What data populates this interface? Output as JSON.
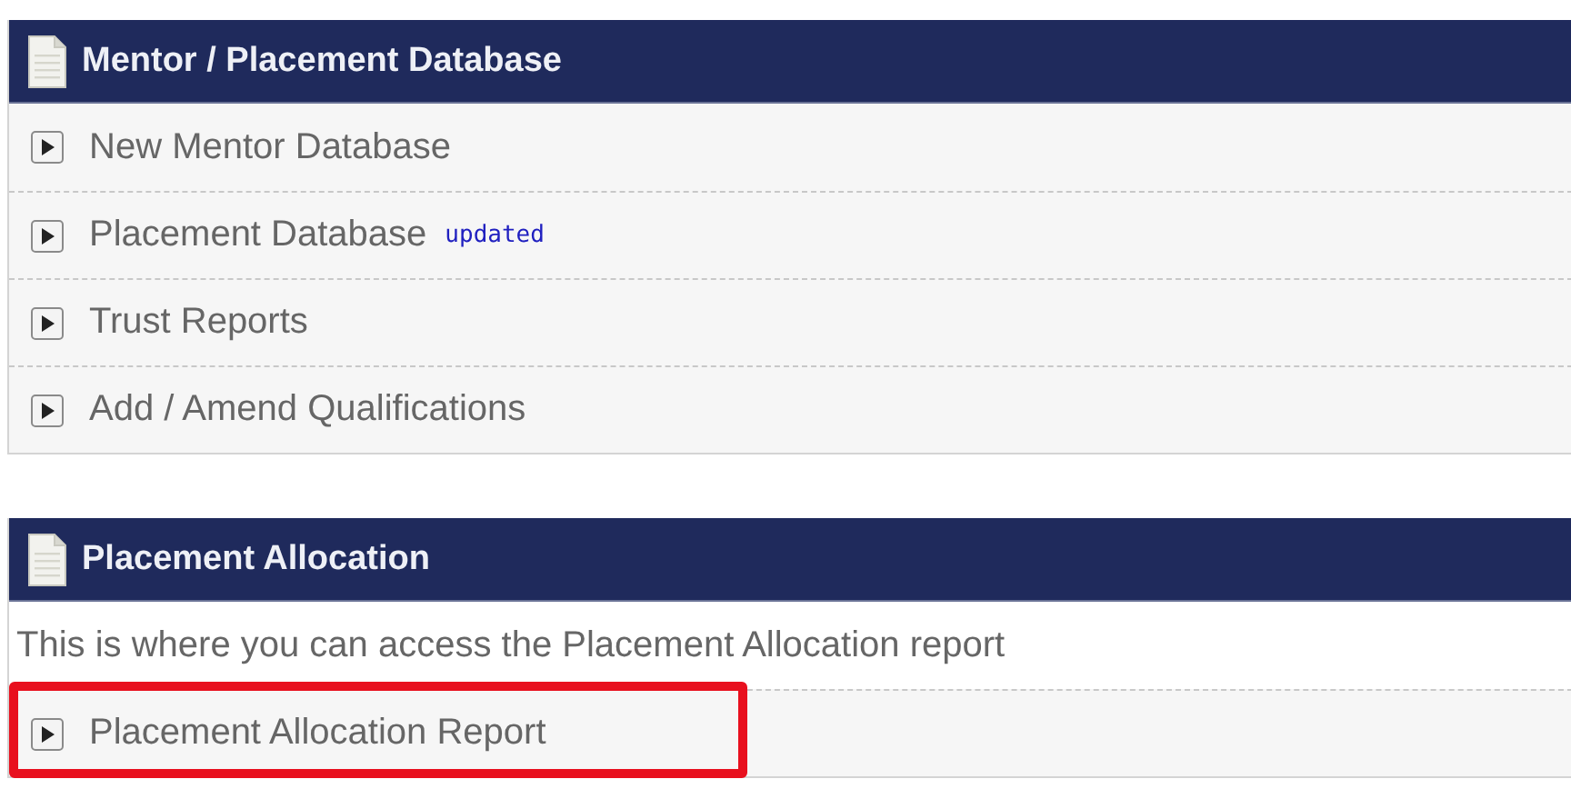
{
  "panels": [
    {
      "title": "Mentor / Placement Database",
      "items": [
        {
          "kind": "link",
          "label": "New Mentor Database",
          "highlighted": false
        },
        {
          "kind": "link",
          "label": "Placement Database",
          "badge": "updated",
          "highlighted": false
        },
        {
          "kind": "link",
          "label": "Trust Reports",
          "highlighted": false
        },
        {
          "kind": "link",
          "label": "Add / Amend Qualifications",
          "highlighted": false
        }
      ]
    },
    {
      "title": "Placement Allocation",
      "items": [
        {
          "kind": "text",
          "label": "This is where you can access the Placement Allocation report"
        },
        {
          "kind": "link",
          "label": "Placement Allocation Report",
          "highlighted": true
        }
      ]
    }
  ]
}
